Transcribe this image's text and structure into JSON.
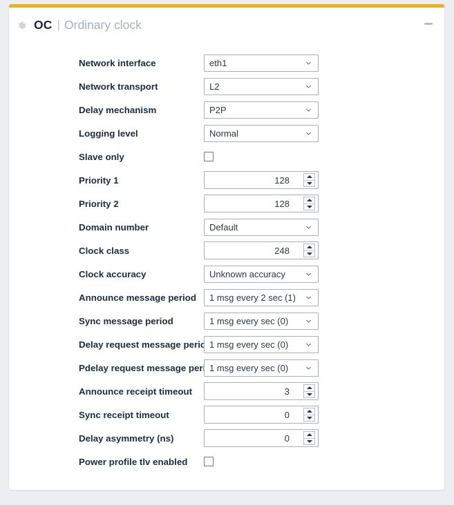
{
  "panel": {
    "gear_icon": "gear-icon",
    "title_code": "OC",
    "title_separator": "|",
    "title_name": "Ordinary clock",
    "minimize_label": "–",
    "accent_color": "#edb11d",
    "background_color": "#eceef2",
    "panel_color": "#ffffff",
    "label_color": "#1e2b3a",
    "control_border_color": "#a9afb8"
  },
  "form": {
    "rows": [
      {
        "label": "Network interface",
        "type": "select",
        "value": "eth1",
        "name": "network-interface"
      },
      {
        "label": "Network transport",
        "type": "select",
        "value": "L2",
        "name": "network-transport"
      },
      {
        "label": "Delay mechanism",
        "type": "select",
        "value": "P2P",
        "name": "delay-mechanism"
      },
      {
        "label": "Logging level",
        "type": "select",
        "value": "Normal",
        "name": "logging-level"
      },
      {
        "label": "Slave only",
        "type": "checkbox",
        "value": "",
        "checked": false,
        "name": "slave-only"
      },
      {
        "label": "Priority 1",
        "type": "spinner",
        "value": "128",
        "name": "priority-1"
      },
      {
        "label": "Priority 2",
        "type": "spinner",
        "value": "128",
        "name": "priority-2"
      },
      {
        "label": "Domain number",
        "type": "select",
        "value": "Default",
        "name": "domain-number"
      },
      {
        "label": "Clock class",
        "type": "spinner",
        "value": "248",
        "name": "clock-class"
      },
      {
        "label": "Clock accuracy",
        "type": "select",
        "value": "Unknown accuracy",
        "name": "clock-accuracy"
      },
      {
        "label": "Announce message period",
        "type": "select",
        "value": "1 msg every 2 sec (1)",
        "name": "announce-message-period"
      },
      {
        "label": "Sync message period",
        "type": "select",
        "value": "1 msg every sec (0)",
        "name": "sync-message-period"
      },
      {
        "label": "Delay request message period",
        "type": "select",
        "value": "1 msg every sec (0)",
        "name": "delay-request-message-period"
      },
      {
        "label": "Pdelay request message period",
        "type": "select",
        "value": "1 msg every sec (0)",
        "name": "pdelay-request-message-period"
      },
      {
        "label": "Announce receipt timeout",
        "type": "spinner",
        "value": "3",
        "name": "announce-receipt-timeout"
      },
      {
        "label": "Sync receipt timeout",
        "type": "spinner",
        "value": "0",
        "name": "sync-receipt-timeout"
      },
      {
        "label": "Delay asymmetry (ns)",
        "type": "spinner",
        "value": "0",
        "name": "delay-asymmetry"
      },
      {
        "label": "Power profile tlv enabled",
        "type": "checkbox",
        "value": "",
        "checked": false,
        "name": "power-profile-tlv-enabled"
      }
    ]
  }
}
